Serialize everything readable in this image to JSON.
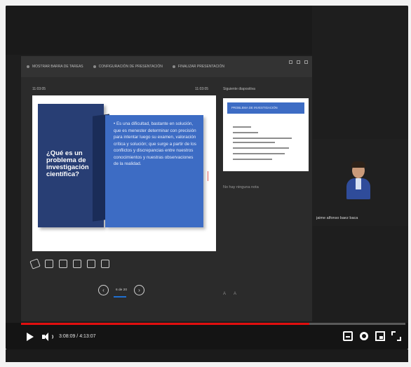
{
  "share_toolbar": {
    "items": [
      "MOSTRAR BARRA DE TAREAS",
      "CONFIGURACIÓN DE PRESENTACIÓN",
      "FINALIZAR PRESENTACIÓN"
    ]
  },
  "presenter": {
    "slide_counter": "11:03:05",
    "slide_counter_right": "11:03:05",
    "next_label": "Siguiente diapositiva",
    "no_notes": "No hay ninguna nota",
    "nav_text": "6 de 20",
    "notes_controls": "A A"
  },
  "slide": {
    "question": "¿Qué es un problema de investigación científica?",
    "bullet": "• Es una dificultad, bastante en solución, que es menester determinar con precisión para intentar luego su examen, valoración crítica y solución; que surge a partir de los conflictos y discrepancias entre nuestros conocimientos y nuestras observaciones de la realidad."
  },
  "next_slide": {
    "heading": "PROBLEMA DE INVESTIGACIÓN"
  },
  "participant": {
    "name": "jaime alfonso baez baca"
  },
  "player": {
    "time": "3:08:09 / 4:13:07",
    "progress_fraction": 0.75
  },
  "colors": {
    "slide_dark": "#283e74",
    "slide_blue": "#3d6cc4",
    "progress_red": "#e10f0f"
  }
}
